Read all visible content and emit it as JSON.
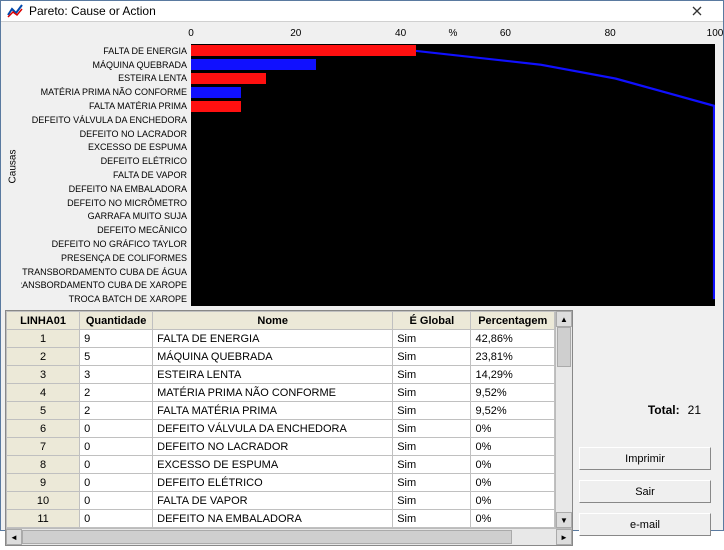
{
  "window": {
    "title": "Pareto: Cause or Action"
  },
  "chart": {
    "ylabel": "Causas",
    "xunit": "%",
    "xticks": [
      "0",
      "20",
      "40",
      "60",
      "80",
      "100"
    ]
  },
  "chart_data": {
    "type": "bar",
    "orientation": "horizontal",
    "xlabel": "%",
    "ylabel": "Causas",
    "xlim": [
      0,
      100
    ],
    "categories": [
      "FALTA DE ENERGIA",
      "MÁQUINA QUEBRADA",
      "ESTEIRA LENTA",
      "MATÉRIA PRIMA NÃO CONFORME",
      "FALTA MATÉRIA PRIMA",
      "DEFEITO VÁLVULA DA ENCHEDORA",
      "DEFEITO NO LACRADOR",
      "EXCESSO DE ESPUMA",
      "DEFEITO ELÉTRICO",
      "FALTA DE VAPOR",
      "DEFEITO NA EMBALADORA",
      "DEFEITO NO MICRÔMETRO",
      "GARRAFA MUITO SUJA",
      "DEFEITO MECÂNICO",
      "DEFEITO NO GRÁFICO TAYLOR",
      "PRESENÇA DE COLIFORMES",
      "TRANSBORDAMENTO CUBA DE ÁGUA",
      "TRANSBORDAMENTO CUBA DE XAROPE",
      "TROCA BATCH DE XAROPE"
    ],
    "series": [
      {
        "name": "Percentagem",
        "color": "#ff0000",
        "values": [
          42.86,
          23.81,
          14.29,
          9.52,
          9.52,
          0,
          0,
          0,
          0,
          0,
          0,
          0,
          0,
          0,
          0,
          0,
          0,
          0,
          0
        ]
      },
      {
        "name": "Cumulative",
        "type": "line",
        "color": "#0000ff",
        "values": [
          42.86,
          66.67,
          80.95,
          90.48,
          100,
          100,
          100,
          100,
          100,
          100,
          100,
          100,
          100,
          100,
          100,
          100,
          100,
          100,
          100
        ]
      }
    ],
    "quantities": [
      9,
      5,
      3,
      2,
      2,
      0,
      0,
      0,
      0,
      0,
      0,
      0,
      0,
      0,
      0,
      0,
      0,
      0,
      0
    ],
    "total": 21
  },
  "table": {
    "headers": [
      "LINHA01",
      "Quantidade",
      "Nome",
      "É Global",
      "Percentagem"
    ],
    "rows": [
      {
        "idx": "1",
        "q": "9",
        "nome": "FALTA DE ENERGIA",
        "g": "Sim",
        "p": "42,86%"
      },
      {
        "idx": "2",
        "q": "5",
        "nome": "MÁQUINA QUEBRADA",
        "g": "Sim",
        "p": "23,81%"
      },
      {
        "idx": "3",
        "q": "3",
        "nome": "ESTEIRA LENTA",
        "g": "Sim",
        "p": "14,29%"
      },
      {
        "idx": "4",
        "q": "2",
        "nome": "MATÉRIA PRIMA NÃO CONFORME",
        "g": "Sim",
        "p": "9,52%"
      },
      {
        "idx": "5",
        "q": "2",
        "nome": "FALTA MATÉRIA PRIMA",
        "g": "Sim",
        "p": "9,52%"
      },
      {
        "idx": "6",
        "q": "0",
        "nome": "DEFEITO VÁLVULA DA ENCHEDORA",
        "g": "Sim",
        "p": "0%"
      },
      {
        "idx": "7",
        "q": "0",
        "nome": "DEFEITO NO LACRADOR",
        "g": "Sim",
        "p": "0%"
      },
      {
        "idx": "8",
        "q": "0",
        "nome": "EXCESSO DE ESPUMA",
        "g": "Sim",
        "p": "0%"
      },
      {
        "idx": "9",
        "q": "0",
        "nome": "DEFEITO ELÉTRICO",
        "g": "Sim",
        "p": "0%"
      },
      {
        "idx": "10",
        "q": "0",
        "nome": "FALTA DE VAPOR",
        "g": "Sim",
        "p": "0%"
      },
      {
        "idx": "11",
        "q": "0",
        "nome": "DEFEITO NA EMBALADORA",
        "g": "Sim",
        "p": "0%"
      }
    ]
  },
  "side": {
    "total_label": "Total:",
    "total_value": "21",
    "print": "Imprimir",
    "exit": "Sair",
    "email": "e-mail"
  }
}
